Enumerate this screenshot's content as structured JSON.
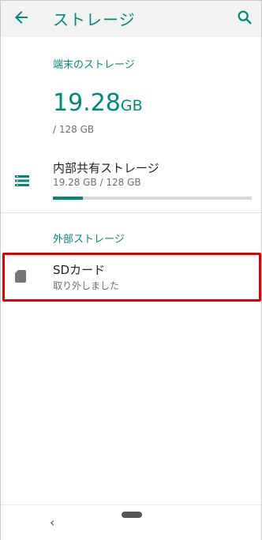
{
  "header": {
    "title": "ストレージ",
    "back_icon": "arrow-left-icon",
    "search_icon": "search-icon"
  },
  "device_storage": {
    "section_title": "端末のストレージ",
    "used_value": "19.28",
    "used_unit": "GB",
    "total_text": "/ 128 GB"
  },
  "internal_storage": {
    "label": "内部共有ストレージ",
    "usage_text": "19.28 GB / 128 GB",
    "used_fraction": 0.15,
    "icon": "storage-list-icon"
  },
  "external_storage": {
    "section_title": "外部ストレージ",
    "sd_label": "SDカード",
    "sd_status": "取り外しました",
    "icon": "sd-card-icon"
  },
  "nav": {
    "back_glyph": "‹"
  },
  "colors": {
    "accent": "#00897b",
    "highlight": "#e00000"
  }
}
